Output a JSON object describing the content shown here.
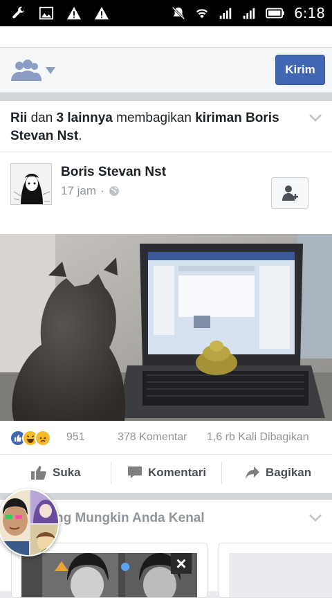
{
  "status_bar": {
    "time": "6:18",
    "left_icons": [
      "wrench-icon",
      "image-icon",
      "warning-icon",
      "warning-icon"
    ],
    "right_icons": [
      "mute-icon",
      "wifi-icon",
      "signal-icon",
      "signal-icon",
      "battery-icon"
    ]
  },
  "composer": {
    "audience_icon": "friends-icon",
    "send_label": "Kirim"
  },
  "post": {
    "share_actor_1": "Rii",
    "share_word_and": "dan",
    "share_actor_others": "3 lainnya",
    "share_verb": "membagikan",
    "share_object": "kiriman Boris Stevan Nst",
    "share_period": ".",
    "author": "Boris Stevan Nst",
    "time": "17 jam",
    "time_separator": "·",
    "privacy_icon": "globe-icon",
    "reactions": {
      "count": "951",
      "icons": [
        "like-icon",
        "haha-icon",
        "sad-icon"
      ]
    },
    "comments": "378 Komentar",
    "shares": "1,6 rb Kali Dibagikan"
  },
  "actions": {
    "like": "Suka",
    "comment": "Komentari",
    "share": "Bagikan"
  },
  "pymk": {
    "title": "rang Mungkin Anda Kenal",
    "close": "×"
  },
  "colors": {
    "accent": "#4267b2",
    "muted": "#90949c",
    "background": "#e9ebee"
  }
}
